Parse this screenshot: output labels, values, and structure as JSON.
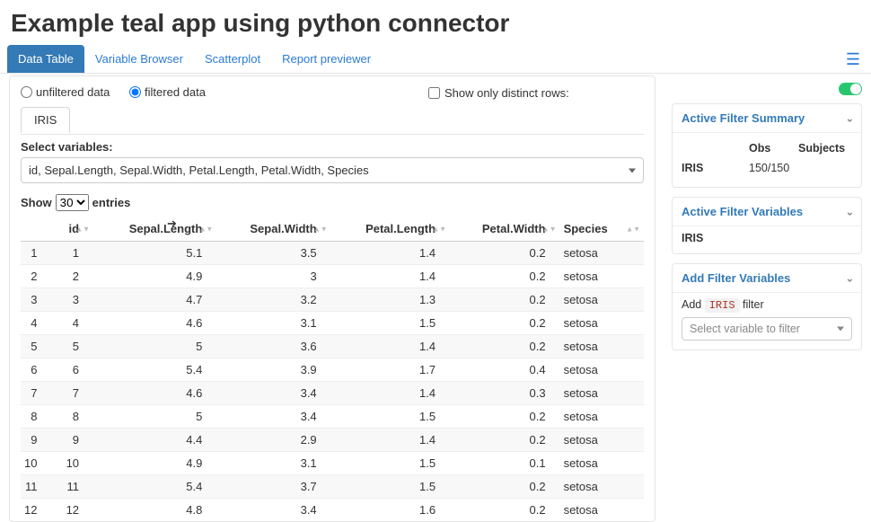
{
  "title": "Example teal app using python connector",
  "tabs": [
    "Data Table",
    "Variable Browser",
    "Scatterplot",
    "Report previewer"
  ],
  "active_tab": 0,
  "radio": {
    "unfiltered": "unfiltered data",
    "filtered": "filtered data",
    "selected": "filtered"
  },
  "distinct_label": "Show only distinct rows:",
  "dataset_tab": "IRIS",
  "select_vars_label": "Select variables:",
  "select_vars_value": "id, Sepal.Length, Sepal.Width, Petal.Length, Petal.Width, Species",
  "show_entries": {
    "prefix": "Show",
    "value": "30",
    "suffix": "entries"
  },
  "columns": [
    "",
    "id",
    "Sepal.Length",
    "Sepal.Width",
    "Petal.Length",
    "Petal.Width",
    "Species"
  ],
  "rows": [
    {
      "idx": "1",
      "id": "1",
      "sl": "5.1",
      "sw": "3.5",
      "pl": "1.4",
      "pw": "0.2",
      "sp": "setosa"
    },
    {
      "idx": "2",
      "id": "2",
      "sl": "4.9",
      "sw": "3",
      "pl": "1.4",
      "pw": "0.2",
      "sp": "setosa"
    },
    {
      "idx": "3",
      "id": "3",
      "sl": "4.7",
      "sw": "3.2",
      "pl": "1.3",
      "pw": "0.2",
      "sp": "setosa"
    },
    {
      "idx": "4",
      "id": "4",
      "sl": "4.6",
      "sw": "3.1",
      "pl": "1.5",
      "pw": "0.2",
      "sp": "setosa"
    },
    {
      "idx": "5",
      "id": "5",
      "sl": "5",
      "sw": "3.6",
      "pl": "1.4",
      "pw": "0.2",
      "sp": "setosa"
    },
    {
      "idx": "6",
      "id": "6",
      "sl": "5.4",
      "sw": "3.9",
      "pl": "1.7",
      "pw": "0.4",
      "sp": "setosa"
    },
    {
      "idx": "7",
      "id": "7",
      "sl": "4.6",
      "sw": "3.4",
      "pl": "1.4",
      "pw": "0.3",
      "sp": "setosa"
    },
    {
      "idx": "8",
      "id": "8",
      "sl": "5",
      "sw": "3.4",
      "pl": "1.5",
      "pw": "0.2",
      "sp": "setosa"
    },
    {
      "idx": "9",
      "id": "9",
      "sl": "4.4",
      "sw": "2.9",
      "pl": "1.4",
      "pw": "0.2",
      "sp": "setosa"
    },
    {
      "idx": "10",
      "id": "10",
      "sl": "4.9",
      "sw": "3.1",
      "pl": "1.5",
      "pw": "0.1",
      "sp": "setosa"
    },
    {
      "idx": "11",
      "id": "11",
      "sl": "5.4",
      "sw": "3.7",
      "pl": "1.5",
      "pw": "0.2",
      "sp": "setosa"
    },
    {
      "idx": "12",
      "id": "12",
      "sl": "4.8",
      "sw": "3.4",
      "pl": "1.6",
      "pw": "0.2",
      "sp": "setosa"
    }
  ],
  "side": {
    "active_summary_title": "Active Filter Summary",
    "summary_head_obs": "Obs",
    "summary_head_subj": "Subjects",
    "summary_ds": "IRIS",
    "summary_obs": "150/150",
    "active_vars_title": "Active Filter Variables",
    "active_vars_ds": "IRIS",
    "add_vars_title": "Add Filter Variables",
    "add_prefix": "Add",
    "add_code": "IRIS",
    "add_suffix": "filter",
    "picker_placeholder": "Select variable to filter"
  }
}
